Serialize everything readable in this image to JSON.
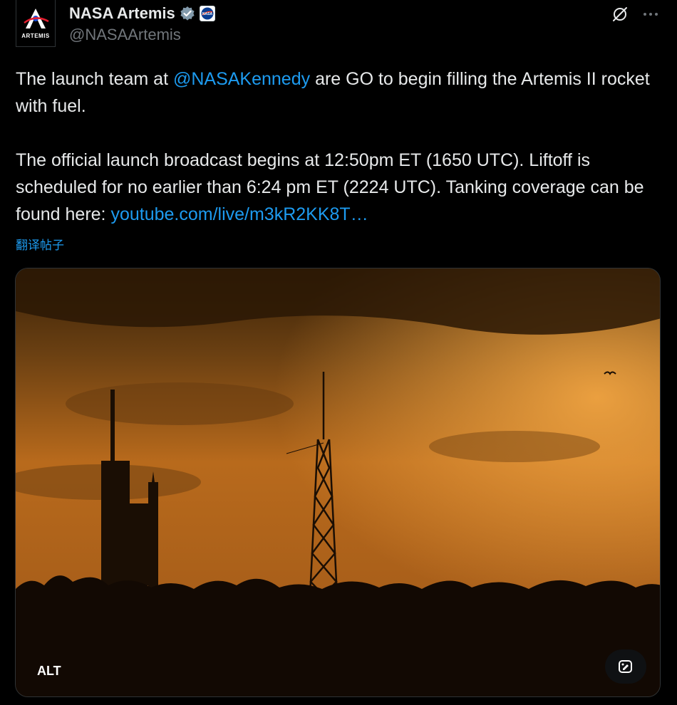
{
  "author": {
    "display_name": "NASA Artemis",
    "handle": "@NASAArtemis",
    "avatar_text": "ARTEMIS",
    "verified_icon": "verified-badge-icon",
    "affiliate_icon": "nasa-logo-icon"
  },
  "actions": {
    "grok_icon": "grok-icon",
    "more_icon": "more-options-icon"
  },
  "tweet": {
    "line1_prefix": "The launch team at ",
    "mention": "@NASAKennedy",
    "line1_suffix": " are GO to begin filling the Artemis II rocket with fuel.",
    "paragraph2": "The official launch broadcast begins at 12:50pm ET (1650 UTC). Liftoff is scheduled for no earlier than 6:24 pm ET (2224 UTC). Tanking coverage can be found here: ",
    "link": "youtube.com/live/m3kR2KK8T…",
    "translate": "翻译帖子"
  },
  "media": {
    "alt_label": "ALT",
    "edit_icon": "edit-image-icon"
  },
  "colors": {
    "background": "#000000",
    "text": "#e7e9ea",
    "secondary": "#71767b",
    "link": "#1d9bf0",
    "sky_top": "#5a3810",
    "sky_mid": "#c8771f",
    "sky_bright": "#f0a040"
  }
}
